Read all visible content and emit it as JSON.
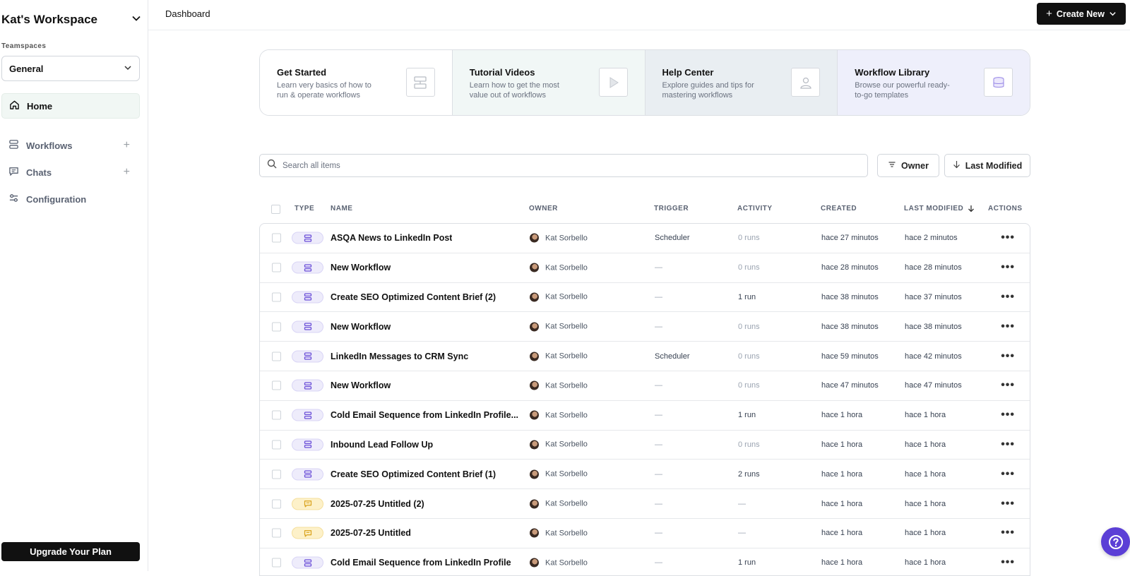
{
  "sidebar": {
    "workspace_title": "Kat's Workspace",
    "teamspaces_label": "Teamspaces",
    "teamspace_selected": "General",
    "nav": {
      "home": "Home",
      "workflows": "Workflows",
      "chats": "Chats",
      "configuration": "Configuration"
    },
    "upgrade_label": "Upgrade Your Plan"
  },
  "topbar": {
    "breadcrumb": "Dashboard",
    "create_label": "Create New"
  },
  "cards": [
    {
      "title": "Get Started",
      "desc": "Learn very basics of how to run & operate workflows",
      "bg": "#ffffff"
    },
    {
      "title": "Tutorial Videos",
      "desc": "Learn how to get the most value out of workflows",
      "bg": "#f1f7f6"
    },
    {
      "title": "Help Center",
      "desc": "Explore guides and tips for mastering workflows",
      "bg": "#e9eef2"
    },
    {
      "title": "Workflow Library",
      "desc": "Browse our powerful ready-to-go templates",
      "bg": "#eeeffb"
    }
  ],
  "search": {
    "placeholder": "Search all items"
  },
  "filters": {
    "owner": "Owner",
    "sort": "Last Modified"
  },
  "table": {
    "headers": {
      "type": "TYPE",
      "name": "NAME",
      "owner": "OWNER",
      "trigger": "TRIGGER",
      "activity": "ACTIVITY",
      "created": "CREATED",
      "last_modified": "LAST MODIFIED",
      "actions": "ACTIONS"
    },
    "rows": [
      {
        "type": "workflow",
        "name": "ASQA News to LinkedIn Post",
        "owner": "Kat Sorbello",
        "trigger": "Scheduler",
        "activity": "0 runs",
        "created": "hace 27 minutos",
        "modified": "hace 2 minutos"
      },
      {
        "type": "workflow",
        "name": "New Workflow",
        "owner": "Kat Sorbello",
        "trigger": "—",
        "activity": "0 runs",
        "created": "hace 28 minutos",
        "modified": "hace 28 minutos"
      },
      {
        "type": "workflow",
        "name": "Create SEO Optimized Content Brief (2)",
        "owner": "Kat Sorbello",
        "trigger": "—",
        "activity": "1 run",
        "created": "hace 38 minutos",
        "modified": "hace 37 minutos"
      },
      {
        "type": "workflow",
        "name": "New Workflow",
        "owner": "Kat Sorbello",
        "trigger": "—",
        "activity": "0 runs",
        "created": "hace 38 minutos",
        "modified": "hace 38 minutos"
      },
      {
        "type": "workflow",
        "name": "LinkedIn Messages to CRM Sync",
        "owner": "Kat Sorbello",
        "trigger": "Scheduler",
        "activity": "0 runs",
        "created": "hace 59 minutos",
        "modified": "hace 42 minutos"
      },
      {
        "type": "workflow",
        "name": "New Workflow",
        "owner": "Kat Sorbello",
        "trigger": "—",
        "activity": "0 runs",
        "created": "hace 47 minutos",
        "modified": "hace 47 minutos"
      },
      {
        "type": "workflow",
        "name": "Cold Email Sequence from LinkedIn Profile...",
        "owner": "Kat Sorbello",
        "trigger": "—",
        "activity": "1 run",
        "created": "hace 1 hora",
        "modified": "hace 1 hora"
      },
      {
        "type": "workflow",
        "name": "Inbound Lead Follow Up",
        "owner": "Kat Sorbello",
        "trigger": "—",
        "activity": "0 runs",
        "created": "hace 1 hora",
        "modified": "hace 1 hora"
      },
      {
        "type": "workflow",
        "name": "Create SEO Optimized Content Brief (1)",
        "owner": "Kat Sorbello",
        "trigger": "—",
        "activity": "2 runs",
        "created": "hace 1 hora",
        "modified": "hace 1 hora"
      },
      {
        "type": "chat",
        "name": "2025-07-25 Untitled (2)",
        "owner": "Kat Sorbello",
        "trigger": "—",
        "activity": "—",
        "created": "hace 1 hora",
        "modified": "hace 1 hora"
      },
      {
        "type": "chat",
        "name": "2025-07-25 Untitled",
        "owner": "Kat Sorbello",
        "trigger": "—",
        "activity": "—",
        "created": "hace 1 hora",
        "modified": "hace 1 hora"
      },
      {
        "type": "workflow",
        "name": "Cold Email Sequence from LinkedIn Profile",
        "owner": "Kat Sorbello",
        "trigger": "—",
        "activity": "1 run",
        "created": "hace 1 hora",
        "modified": "hace 1 hora"
      }
    ]
  },
  "colors": {
    "accent": "#5b3fd6",
    "workflow_icon": "#6b4fd8",
    "chat_icon": "#d9a21b"
  },
  "icons": {
    "help": "help-icon",
    "search": "search-icon",
    "home": "home-icon",
    "workflow": "workflow-icon",
    "chat": "chat-icon",
    "config": "sliders-icon"
  }
}
